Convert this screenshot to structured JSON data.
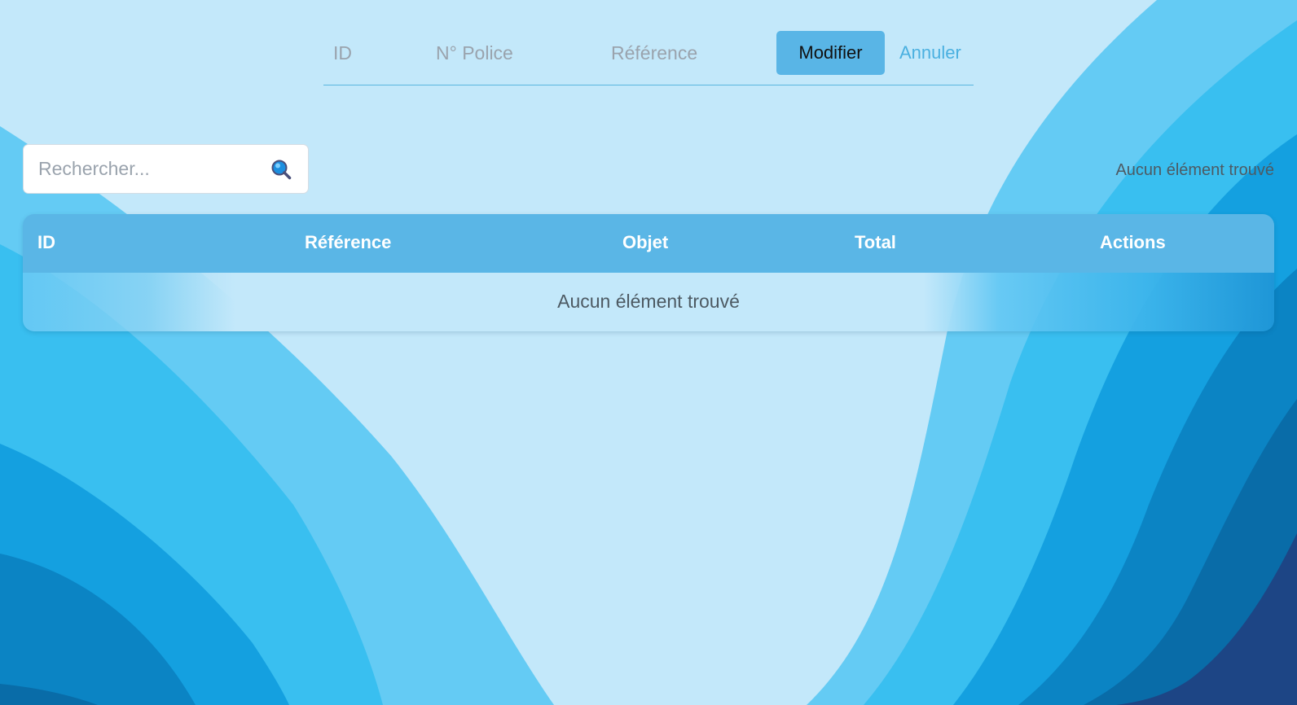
{
  "filters": {
    "fields": [
      "ID",
      "N° Police",
      "Référence"
    ],
    "modifier_label": "Modifier",
    "annuler_label": "Annuler"
  },
  "search": {
    "placeholder": "Rechercher...",
    "value": "",
    "icon": "search-icon"
  },
  "status_text": "Aucun élément trouvé",
  "table": {
    "columns": [
      "ID",
      "Référence",
      "Objet",
      "Total",
      "Actions"
    ],
    "empty_message": "Aucun élément trouvé"
  },
  "colors": {
    "background": "#c3e8fa",
    "accent": "#59b5e6",
    "header": "#5ab6e6"
  }
}
